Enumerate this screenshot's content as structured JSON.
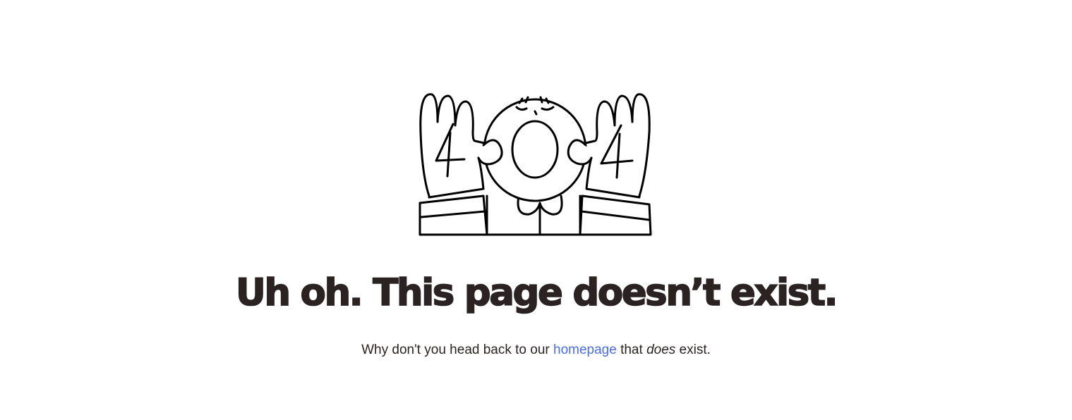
{
  "illustration": {
    "icon": "404-character-illustration-icon",
    "digit_left": "4",
    "digit_center": "0",
    "digit_right": "4"
  },
  "headline": "Uh oh. This page doesn’t exist.",
  "message": {
    "before_link": "Why don't you head back to our ",
    "link_label": "homepage",
    "between": " that ",
    "emphasis": "does",
    "after": " exist."
  },
  "colors": {
    "text": "#2a2322",
    "link": "#4a6ee0",
    "background": "#ffffff"
  }
}
